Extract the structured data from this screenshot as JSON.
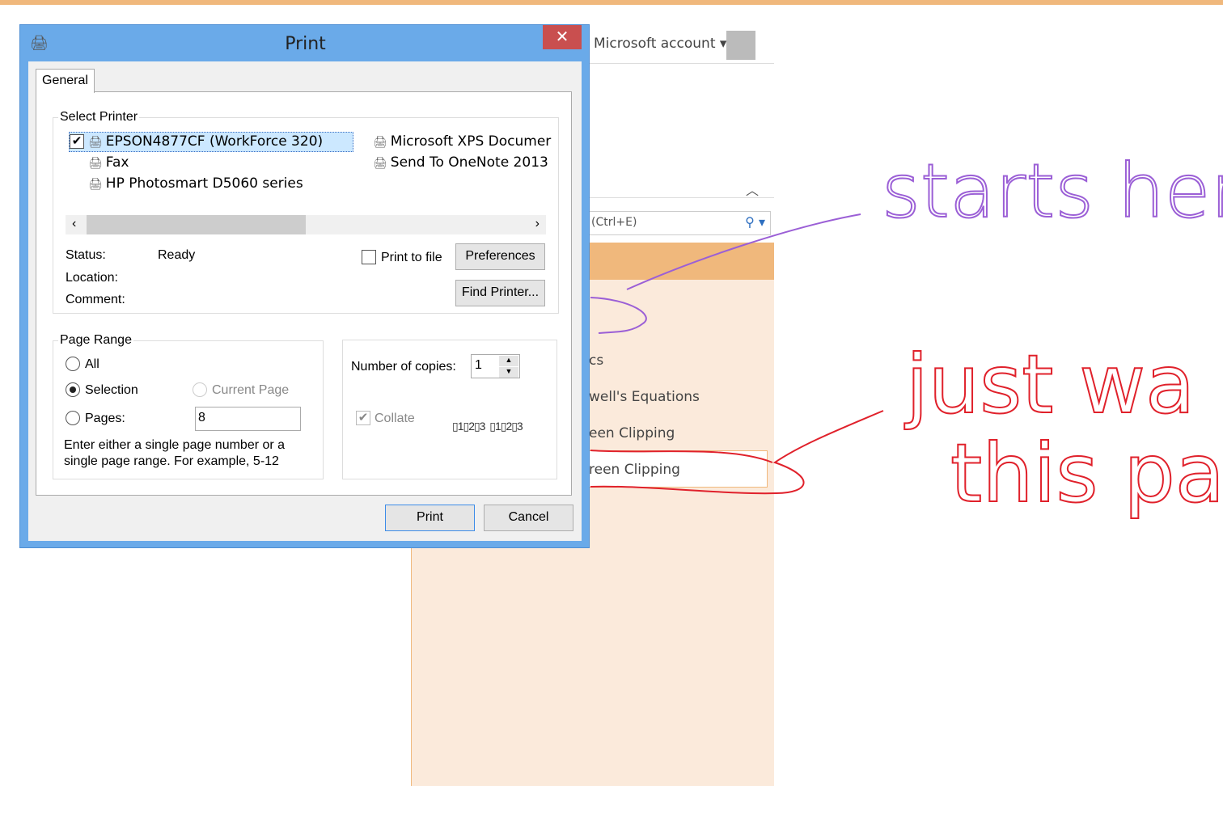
{
  "background": {
    "account": "Microsoft account",
    "search_hint": "(Ctrl+E)",
    "pages": [
      "cs",
      "well's Equations",
      "een Clipping",
      "reen Clipping"
    ],
    "accent": "#f0b87c"
  },
  "dialog": {
    "title": "Print",
    "close": "✕",
    "tab": "General",
    "select_printer": {
      "legend": "Select Printer",
      "printers": [
        "EPSON4877CF (WorkForce 320)",
        "Fax",
        "HP Photosmart D5060 series",
        "Microsoft XPS Documer",
        "Send To OneNote 2013"
      ],
      "selected": "EPSON4877CF (WorkForce 320)"
    },
    "status_label": "Status:",
    "status_value": "Ready",
    "location_label": "Location:",
    "comment_label": "Comment:",
    "print_to_file": "Print to file",
    "preferences": "Preferences",
    "find_printer": "Find Printer...",
    "page_range": {
      "legend": "Page Range",
      "all": "All",
      "selection": "Selection",
      "current_page": "Current Page",
      "pages": "Pages:",
      "pages_value": "8",
      "hint1": "Enter either a single page number or a",
      "hint2": "single page range.  For example, 5-12",
      "selected": "Selection"
    },
    "copies_label": "Number of copies:",
    "copies_value": "1",
    "collate": "Collate",
    "collate_checked": true,
    "print": "Print",
    "cancel": "Cancel",
    "title_color": "#6aaae9"
  },
  "ink": {
    "annotations": [
      "starts here",
      "just wa",
      "this pa"
    ],
    "colors": [
      "#9b5fd6",
      "#e0212b"
    ]
  }
}
